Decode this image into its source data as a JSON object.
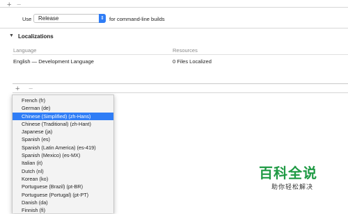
{
  "build_config": {
    "use_label": "Use",
    "selected_configuration": "Release",
    "for_label": "for command-line builds"
  },
  "localizations": {
    "section_title": "Localizations",
    "columns": {
      "language": "Language",
      "resources": "Resources"
    },
    "rows": [
      {
        "language": "English — Development Language",
        "resources": "0 Files Localized"
      }
    ]
  },
  "language_menu": {
    "items": [
      {
        "label": "French (fr)",
        "selected": false
      },
      {
        "label": "German (de)",
        "selected": false
      },
      {
        "label": "Chinese (Simplified) (zh-Hans)",
        "selected": true
      },
      {
        "label": "Chinese (Traditional) (zh-Hant)",
        "selected": false
      },
      {
        "label": "Japanese (ja)",
        "selected": false
      },
      {
        "label": "Spanish (es)",
        "selected": false
      },
      {
        "label": "Spanish (Latin America) (es-419)",
        "selected": false
      },
      {
        "label": "Spanish (Mexico) (es-MX)",
        "selected": false
      },
      {
        "label": "Italian (it)",
        "selected": false
      },
      {
        "label": "Dutch (nl)",
        "selected": false
      },
      {
        "label": "Korean (ko)",
        "selected": false
      },
      {
        "label": "Portuguese (Brazil) (pt-BR)",
        "selected": false
      },
      {
        "label": "Portuguese (Portugal) (pt-PT)",
        "selected": false
      },
      {
        "label": "Danish (da)",
        "selected": false
      },
      {
        "label": "Finnish (fi)",
        "selected": false
      }
    ]
  },
  "watermark": {
    "brand": "百科全说",
    "tagline": "助你轻松解决"
  },
  "colors": {
    "accent": "#2f7df6",
    "watermark_green": "#1f9a44"
  }
}
